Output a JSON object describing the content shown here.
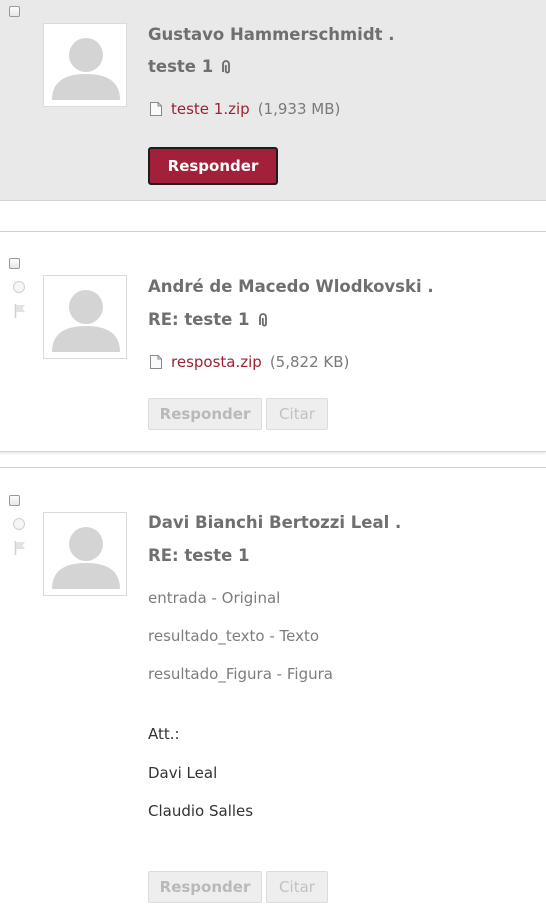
{
  "posts": [
    {
      "author": "Gustavo Hammerschmidt .",
      "subject": "teste 1",
      "attachment": {
        "name": "teste 1.zip",
        "size": "(1,933 MB)"
      },
      "reply_label": "Responder"
    },
    {
      "author": "André de Macedo Wlodkovski .",
      "subject": "RE: teste 1",
      "attachment": {
        "name": "resposta.zip",
        "size": "(5,822 KB)"
      },
      "reply_label": "Responder",
      "cite_label": "Citar"
    },
    {
      "author": "Davi Bianchi Bertozzi Leal .",
      "subject": "RE: teste 1",
      "body": [
        "entrada - Original",
        "resultado_texto - Texto",
        "resultado_Figura - Figura",
        "Att.:",
        "Davi Leal",
        "Claudio Salles"
      ],
      "reply_label": "Responder",
      "cite_label": "Citar"
    }
  ],
  "colors": {
    "accent": "#a3203a",
    "link": "#9b2235",
    "highlight_bg": "#e9e9e9"
  }
}
